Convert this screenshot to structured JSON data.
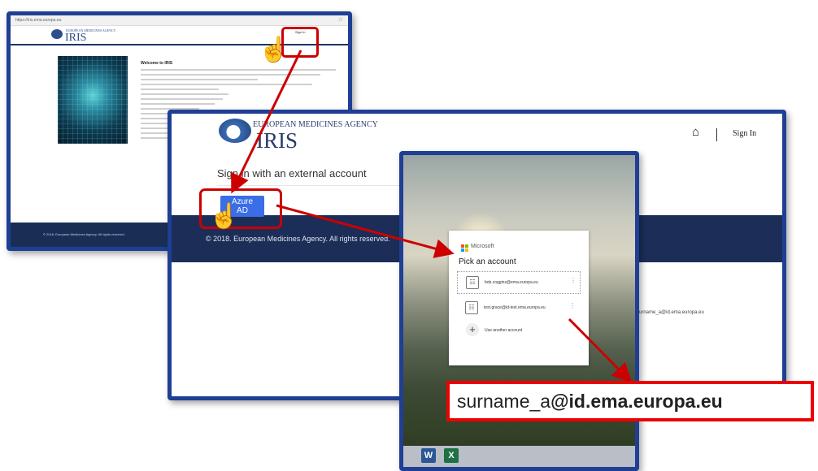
{
  "screen1": {
    "url": "https://iris.ema.europa.eu",
    "agency": "EUROPEAN MEDICINES AGENCY",
    "logo_text": "IRIS",
    "sign_in": "Sign In",
    "welcome": "Welcome to IRIS",
    "footer": "© 2018. European Medicines Agency. All rights reserved."
  },
  "screen2": {
    "agency": "EUROPEAN MEDICINES AGENCY",
    "logo_text": "IRIS",
    "home_icon": "home-icon",
    "sign_in": "Sign In",
    "subtitle": "Sign in with an external account",
    "azure_button": "Azure AD",
    "footer": "© 2018. European Medicines Agency. All rights reserved.",
    "side_email": "surname_a@id.ema.europa.eu"
  },
  "screen3": {
    "brand": "Microsoft",
    "heading": "Pick an account",
    "accounts": [
      {
        "email": "bob.coggins@ema.europa.eu"
      },
      {
        "email": "test.grace@id-test.ema.europa.eu"
      }
    ],
    "use_another": "Use another account",
    "ms_colors": [
      "#f25022",
      "#7fba00",
      "#00a4ef",
      "#ffb900"
    ]
  },
  "callout": {
    "prefix": "surname_a",
    "domain": "@id.ema.europa.eu"
  },
  "colors": {
    "frame": "#1f3f94",
    "highlight": "#cc0000",
    "band": "#1c2e58",
    "azure": "#3a6de6"
  }
}
